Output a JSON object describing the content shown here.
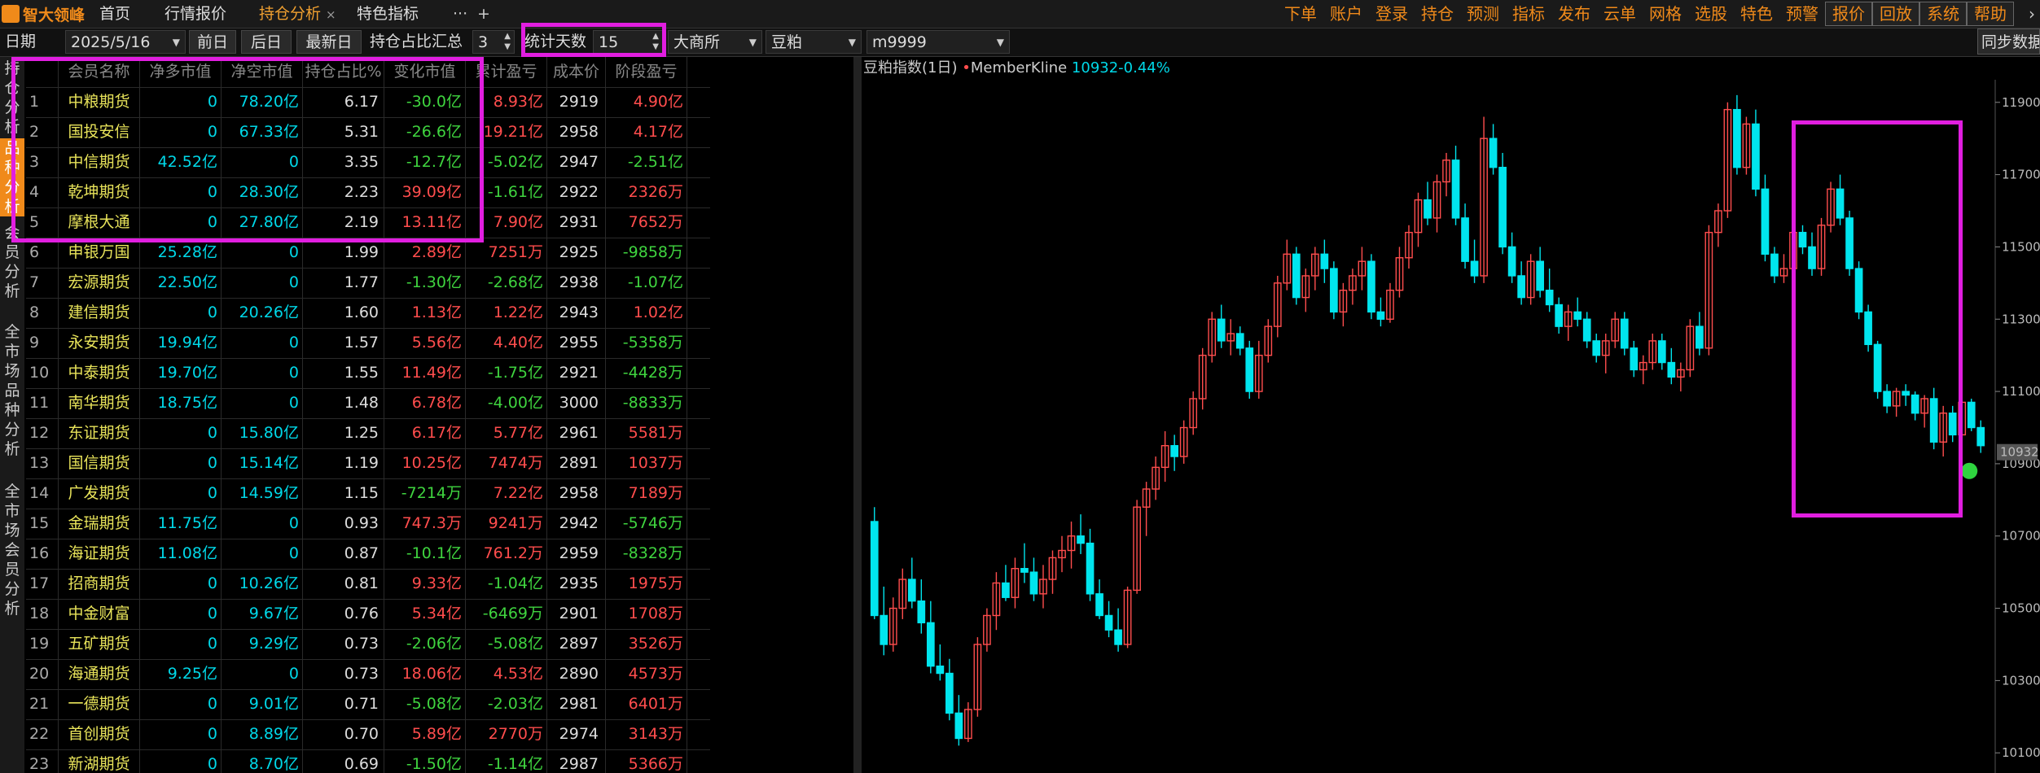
{
  "app": {
    "logo_text": "智大领峰"
  },
  "tabs": [
    {
      "label": "首页"
    },
    {
      "label": "行情报价"
    },
    {
      "label": "持仓分析",
      "close": "×"
    },
    {
      "label": "特色指标"
    },
    {
      "label": "···"
    },
    {
      "label": "+"
    }
  ],
  "menu": [
    "下单",
    "账户",
    "登录",
    "持仓",
    "预测",
    "指标",
    "发布",
    "云单",
    "网格",
    "选股",
    "特色",
    "预警",
    "报价",
    "回放",
    "系统",
    "帮助"
  ],
  "menu_more": "›",
  "toolbar": {
    "date_label": "日期",
    "date_value": "2025/5/16",
    "prev_day": "前日",
    "next_day": "后日",
    "latest_day": "最新日",
    "ratio_sum_label": "持仓占比汇总",
    "ratio_sum_value": "3",
    "stat_days_label": "统计天数",
    "stat_days_value": "15",
    "exchange": "大商所",
    "variety": "豆粕",
    "contract": "m9999",
    "sync_label": "同步数据"
  },
  "sidebar": [
    {
      "label": "持仓分析",
      "active": false
    },
    {
      "label": "品种分析",
      "active": true
    },
    {
      "label": "会员分析",
      "active": false
    },
    {
      "label": "全市场品种分析",
      "active": false
    },
    {
      "label": "全市场会员分析",
      "active": false
    }
  ],
  "table": {
    "headers": [
      "",
      "会员名称",
      "净多市值",
      "净空市值",
      "持仓占比%",
      "变化市值",
      "累计盈亏",
      "成本价",
      "阶段盈亏"
    ],
    "rows": [
      [
        "1",
        "中粮期货",
        "0",
        "78.20亿",
        "6.17",
        "-30.0亿",
        "8.93亿",
        "2919",
        "4.90亿"
      ],
      [
        "2",
        "国投安信",
        "0",
        "67.33亿",
        "5.31",
        "-26.6亿",
        "19.21亿",
        "2958",
        "4.17亿"
      ],
      [
        "3",
        "中信期货",
        "42.52亿",
        "0",
        "3.35",
        "-12.7亿",
        "-5.02亿",
        "2947",
        "-2.51亿"
      ],
      [
        "4",
        "乾坤期货",
        "0",
        "28.30亿",
        "2.23",
        "39.09亿",
        "-1.61亿",
        "2922",
        "2326万"
      ],
      [
        "5",
        "摩根大通",
        "0",
        "27.80亿",
        "2.19",
        "13.11亿",
        "7.90亿",
        "2931",
        "7652万"
      ],
      [
        "6",
        "申银万国",
        "25.28亿",
        "0",
        "1.99",
        "2.89亿",
        "7251万",
        "2925",
        "-9858万"
      ],
      [
        "7",
        "宏源期货",
        "22.50亿",
        "0",
        "1.77",
        "-1.30亿",
        "-2.68亿",
        "2938",
        "-1.07亿"
      ],
      [
        "8",
        "建信期货",
        "0",
        "20.26亿",
        "1.60",
        "1.13亿",
        "1.22亿",
        "2943",
        "1.02亿"
      ],
      [
        "9",
        "永安期货",
        "19.94亿",
        "0",
        "1.57",
        "5.56亿",
        "4.40亿",
        "2955",
        "-5358万"
      ],
      [
        "10",
        "中泰期货",
        "19.70亿",
        "0",
        "1.55",
        "11.49亿",
        "-1.75亿",
        "2921",
        "-4428万"
      ],
      [
        "11",
        "南华期货",
        "18.75亿",
        "0",
        "1.48",
        "6.78亿",
        "-4.00亿",
        "3000",
        "-8833万"
      ],
      [
        "12",
        "东证期货",
        "0",
        "15.80亿",
        "1.25",
        "6.17亿",
        "5.77亿",
        "2961",
        "5581万"
      ],
      [
        "13",
        "国信期货",
        "0",
        "15.14亿",
        "1.19",
        "10.25亿",
        "7474万",
        "2891",
        "1037万"
      ],
      [
        "14",
        "广发期货",
        "0",
        "14.59亿",
        "1.15",
        "-7214万",
        "7.22亿",
        "2958",
        "7189万"
      ],
      [
        "15",
        "金瑞期货",
        "11.75亿",
        "0",
        "0.93",
        "747.3万",
        "9241万",
        "2942",
        "-5746万"
      ],
      [
        "16",
        "海证期货",
        "11.08亿",
        "0",
        "0.87",
        "-10.1亿",
        "761.2万",
        "2959",
        "-8328万"
      ],
      [
        "17",
        "招商期货",
        "0",
        "10.26亿",
        "0.81",
        "9.33亿",
        "-1.04亿",
        "2935",
        "1975万"
      ],
      [
        "18",
        "中金财富",
        "0",
        "9.67亿",
        "0.76",
        "5.34亿",
        "-6469万",
        "2901",
        "1708万"
      ],
      [
        "19",
        "五矿期货",
        "0",
        "9.29亿",
        "0.73",
        "-2.06亿",
        "-5.08亿",
        "2897",
        "3526万"
      ],
      [
        "20",
        "海通期货",
        "9.25亿",
        "0",
        "0.73",
        "18.06亿",
        "4.53亿",
        "2890",
        "4573万"
      ],
      [
        "21",
        "一德期货",
        "0",
        "9.01亿",
        "0.71",
        "-5.08亿",
        "-2.03亿",
        "2981",
        "6401万"
      ],
      [
        "22",
        "首创期货",
        "0",
        "8.89亿",
        "0.70",
        "5.89亿",
        "2770万",
        "2974",
        "3143万"
      ],
      [
        "23",
        "新湖期货",
        "0",
        "8.70亿",
        "0.69",
        "-1.50亿",
        "-1.14亿",
        "2987",
        "5366万"
      ]
    ]
  },
  "chart_title": {
    "name": "豆粕指数(1日)",
    "dot": "•",
    "indicator": "MemberKline",
    "value": "10932-0.44%"
  },
  "colors": {
    "up": "#ff4d4d",
    "down": "#00e5ee",
    "accent": "#f08a1a",
    "highlight": "#e11ee0"
  },
  "chart_data": {
    "type": "candlestick",
    "title": "豆粕指数(1日)",
    "y_ticks": [
      11900,
      11700,
      11500,
      11300,
      11100,
      10900,
      10700,
      10500,
      10300,
      10100
    ],
    "last_price": 10932,
    "ylim": [
      10060,
      11940
    ],
    "candles": [
      [
        10740,
        10780,
        10470,
        10480
      ],
      [
        10480,
        10560,
        10370,
        10400
      ],
      [
        10400,
        10530,
        10380,
        10500
      ],
      [
        10500,
        10610,
        10470,
        10580
      ],
      [
        10580,
        10640,
        10500,
        10520
      ],
      [
        10520,
        10580,
        10430,
        10460
      ],
      [
        10460,
        10520,
        10320,
        10340
      ],
      [
        10340,
        10400,
        10300,
        10320
      ],
      [
        10320,
        10360,
        10190,
        10210
      ],
      [
        10210,
        10260,
        10120,
        10140
      ],
      [
        10140,
        10240,
        10130,
        10220
      ],
      [
        10220,
        10420,
        10200,
        10400
      ],
      [
        10400,
        10500,
        10380,
        10480
      ],
      [
        10480,
        10600,
        10440,
        10570
      ],
      [
        10570,
        10620,
        10520,
        10530
      ],
      [
        10530,
        10640,
        10500,
        10610
      ],
      [
        10610,
        10680,
        10570,
        10600
      ],
      [
        10600,
        10640,
        10520,
        10540
      ],
      [
        10540,
        10620,
        10500,
        10580
      ],
      [
        10580,
        10660,
        10540,
        10640
      ],
      [
        10640,
        10700,
        10600,
        10660
      ],
      [
        10660,
        10740,
        10610,
        10700
      ],
      [
        10700,
        10760,
        10650,
        10680
      ],
      [
        10680,
        10720,
        10520,
        10540
      ],
      [
        10540,
        10580,
        10470,
        10480
      ],
      [
        10480,
        10520,
        10420,
        10440
      ],
      [
        10440,
        10500,
        10380,
        10400
      ],
      [
        10400,
        10560,
        10390,
        10550
      ],
      [
        10550,
        10800,
        10540,
        10780
      ],
      [
        10780,
        10850,
        10700,
        10830
      ],
      [
        10830,
        10920,
        10800,
        10890
      ],
      [
        10890,
        10990,
        10850,
        10950
      ],
      [
        10950,
        10980,
        10880,
        10920
      ],
      [
        10920,
        11020,
        10900,
        11000
      ],
      [
        11000,
        11100,
        10980,
        11080
      ],
      [
        11080,
        11220,
        11050,
        11200
      ],
      [
        11200,
        11320,
        11180,
        11300
      ],
      [
        11300,
        11340,
        11220,
        11240
      ],
      [
        11240,
        11300,
        11200,
        11260
      ],
      [
        11260,
        11280,
        11200,
        11220
      ],
      [
        11220,
        11240,
        11080,
        11100
      ],
      [
        11100,
        11240,
        11080,
        11200
      ],
      [
        11200,
        11300,
        11180,
        11280
      ],
      [
        11280,
        11420,
        11250,
        11400
      ],
      [
        11400,
        11520,
        11380,
        11480
      ],
      [
        11480,
        11500,
        11340,
        11360
      ],
      [
        11360,
        11440,
        11320,
        11420
      ],
      [
        11420,
        11500,
        11380,
        11480
      ],
      [
        11480,
        11520,
        11400,
        11440
      ],
      [
        11440,
        11460,
        11300,
        11320
      ],
      [
        11320,
        11400,
        11280,
        11380
      ],
      [
        11380,
        11440,
        11340,
        11420
      ],
      [
        11420,
        11500,
        11380,
        11460
      ],
      [
        11460,
        11480,
        11300,
        11320
      ],
      [
        11320,
        11360,
        11280,
        11300
      ],
      [
        11300,
        11400,
        11290,
        11380
      ],
      [
        11380,
        11500,
        11360,
        11470
      ],
      [
        11470,
        11560,
        11440,
        11540
      ],
      [
        11540,
        11650,
        11500,
        11630
      ],
      [
        11630,
        11680,
        11560,
        11580
      ],
      [
        11580,
        11700,
        11540,
        11680
      ],
      [
        11680,
        11760,
        11640,
        11740
      ],
      [
        11740,
        11780,
        11560,
        11580
      ],
      [
        11580,
        11620,
        11440,
        11460
      ],
      [
        11460,
        11520,
        11400,
        11420
      ],
      [
        11420,
        11860,
        11400,
        11800
      ],
      [
        11800,
        11840,
        11700,
        11720
      ],
      [
        11720,
        11760,
        11480,
        11500
      ],
      [
        11500,
        11540,
        11400,
        11420
      ],
      [
        11420,
        11460,
        11340,
        11360
      ],
      [
        11360,
        11480,
        11340,
        11460
      ],
      [
        11460,
        11500,
        11360,
        11380
      ],
      [
        11380,
        11440,
        11320,
        11340
      ],
      [
        11340,
        11360,
        11260,
        11280
      ],
      [
        11280,
        11340,
        11240,
        11320
      ],
      [
        11320,
        11360,
        11280,
        11300
      ],
      [
        11300,
        11320,
        11220,
        11240
      ],
      [
        11240,
        11260,
        11180,
        11200
      ],
      [
        11200,
        11260,
        11150,
        11240
      ],
      [
        11240,
        11320,
        11220,
        11300
      ],
      [
        11300,
        11320,
        11200,
        11220
      ],
      [
        11220,
        11240,
        11140,
        11160
      ],
      [
        11160,
        11200,
        11120,
        11180
      ],
      [
        11180,
        11260,
        11160,
        11240
      ],
      [
        11240,
        11260,
        11160,
        11180
      ],
      [
        11180,
        11220,
        11120,
        11140
      ],
      [
        11140,
        11180,
        11100,
        11160
      ],
      [
        11160,
        11300,
        11140,
        11280
      ],
      [
        11280,
        11320,
        11200,
        11220
      ],
      [
        11220,
        11560,
        11200,
        11540
      ],
      [
        11540,
        11620,
        11500,
        11600
      ],
      [
        11600,
        11900,
        11580,
        11880
      ],
      [
        11880,
        11920,
        11700,
        11720
      ],
      [
        11720,
        11860,
        11700,
        11840
      ],
      [
        11840,
        11880,
        11640,
        11660
      ],
      [
        11660,
        11700,
        11460,
        11480
      ],
      [
        11480,
        11500,
        11400,
        11420
      ],
      [
        11420,
        11480,
        11400,
        11440
      ],
      [
        11440,
        11560,
        11420,
        11540
      ],
      [
        11540,
        11560,
        11480,
        11500
      ],
      [
        11500,
        11540,
        11420,
        11440
      ],
      [
        11440,
        11580,
        11420,
        11560
      ],
      [
        11560,
        11680,
        11540,
        11660
      ],
      [
        11660,
        11700,
        11560,
        11580
      ],
      [
        11580,
        11600,
        11420,
        11440
      ],
      [
        11440,
        11460,
        11300,
        11320
      ],
      [
        11320,
        11340,
        11210,
        11230
      ],
      [
        11230,
        11240,
        11080,
        11100
      ],
      [
        11100,
        11120,
        11040,
        11060
      ],
      [
        11060,
        11110,
        11030,
        11100
      ],
      [
        11100,
        11120,
        11060,
        11090
      ],
      [
        11090,
        11100,
        11020,
        11040
      ],
      [
        11040,
        11090,
        11000,
        11080
      ],
      [
        11080,
        11110,
        10940,
        10960
      ],
      [
        10960,
        11060,
        10920,
        11040
      ],
      [
        11040,
        11060,
        10960,
        10980
      ],
      [
        10980,
        11080,
        10960,
        11070
      ],
      [
        11070,
        11080,
        10990,
        11000
      ],
      [
        11000,
        11020,
        10930,
        10950
      ]
    ]
  }
}
